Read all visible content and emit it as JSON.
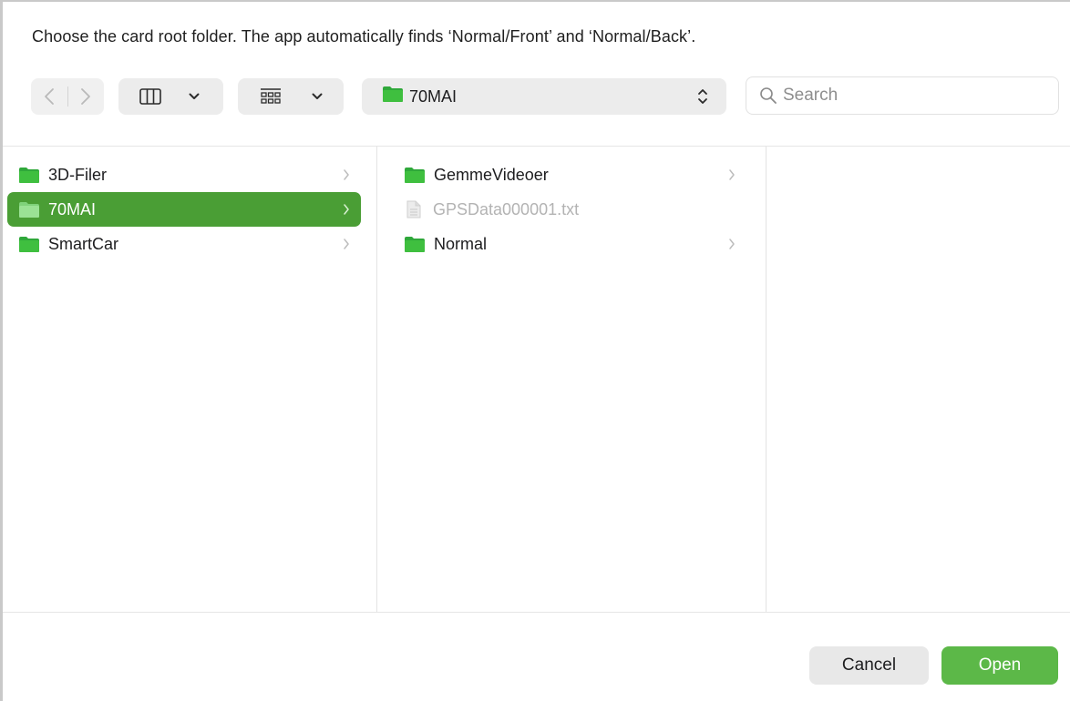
{
  "dialog": {
    "message": "Choose the card root folder. The app automatically finds ‘Normal/Front’ and ‘Normal/Back’."
  },
  "toolbar": {
    "back_icon": "chevron-left-icon",
    "forward_icon": "chevron-right-icon",
    "view_mode_icon": "column-view-icon",
    "group_icon": "icon-grid-icon",
    "path_popup_label": "70MAI",
    "search_placeholder": "Search",
    "search_value": ""
  },
  "browser": {
    "columns": [
      {
        "items": [
          {
            "label": "3D-Filer",
            "icon": "folder-icon",
            "has_children": true,
            "selected": false
          },
          {
            "label": "70MAI",
            "icon": "folder-icon",
            "has_children": true,
            "selected": true
          },
          {
            "label": "SmartCar",
            "icon": "folder-icon",
            "has_children": true,
            "selected": false
          }
        ]
      },
      {
        "items": [
          {
            "label": "GemmeVideoer",
            "icon": "folder-icon",
            "has_children": true,
            "selected": false
          },
          {
            "label": "GPSData000001.txt",
            "icon": "document-icon",
            "has_children": false,
            "disabled": true
          },
          {
            "label": "Normal",
            "icon": "folder-icon",
            "has_children": true,
            "selected": false
          }
        ]
      },
      {
        "items": []
      }
    ]
  },
  "buttons": {
    "cancel": "Cancel",
    "open": "Open"
  },
  "colors": {
    "accent": "#5cb848",
    "selection": "#4a9e35",
    "folder": "#3fbf3f"
  }
}
